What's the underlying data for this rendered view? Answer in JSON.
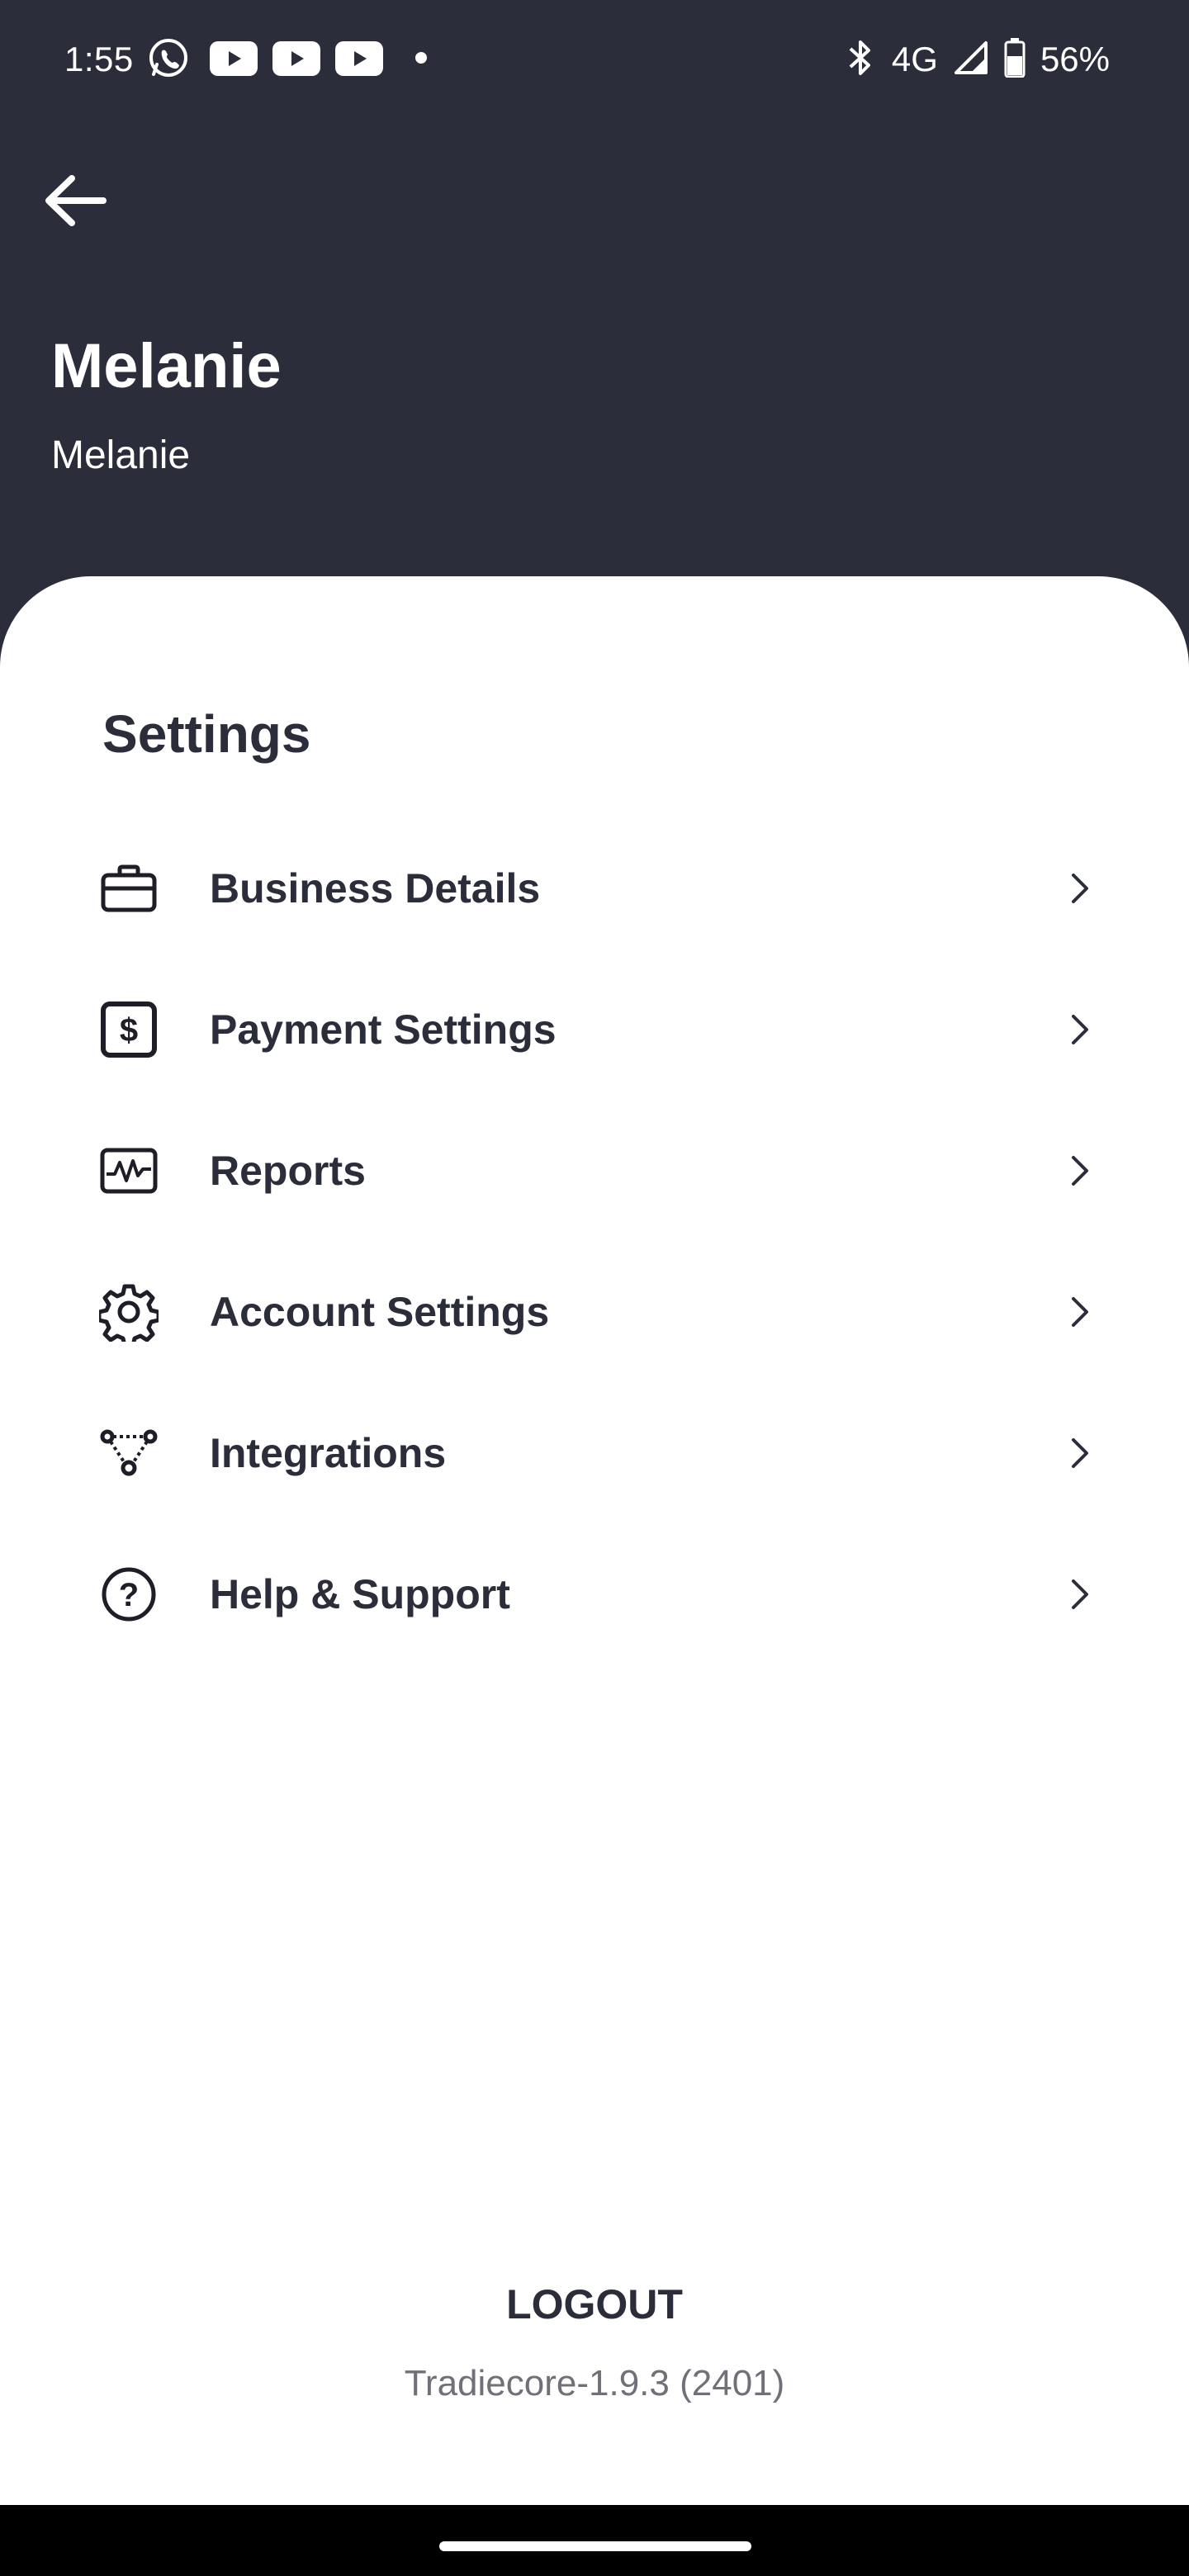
{
  "status_bar": {
    "time": "1:55",
    "network": "4G",
    "battery": "56%",
    "icons": [
      "whatsapp-icon",
      "youtube-icon",
      "youtube-icon",
      "youtube-icon",
      "dot-icon",
      "bluetooth-icon",
      "signal-icon",
      "battery-icon"
    ]
  },
  "header": {
    "back_icon": "arrow-left-icon",
    "name": "Melanie",
    "subtitle": "Melanie"
  },
  "settings": {
    "title": "Settings",
    "items": [
      {
        "label": "Business Details",
        "icon": "briefcase-icon"
      },
      {
        "label": "Payment Settings",
        "icon": "dollar-icon"
      },
      {
        "label": "Reports",
        "icon": "activity-chart-icon"
      },
      {
        "label": "Account Settings",
        "icon": "gear-icon"
      },
      {
        "label": "Integrations",
        "icon": "integrations-icon"
      },
      {
        "label": "Help & Support",
        "icon": "help-circle-icon"
      }
    ]
  },
  "footer": {
    "logout_label": "LOGOUT",
    "version": "Tradiecore-1.9.3 (2401)"
  },
  "colors": {
    "header_bg": "#2b2d3a",
    "sheet_bg": "#ffffff",
    "text_dark": "#2b2d3a",
    "text_muted": "#6f7078"
  }
}
